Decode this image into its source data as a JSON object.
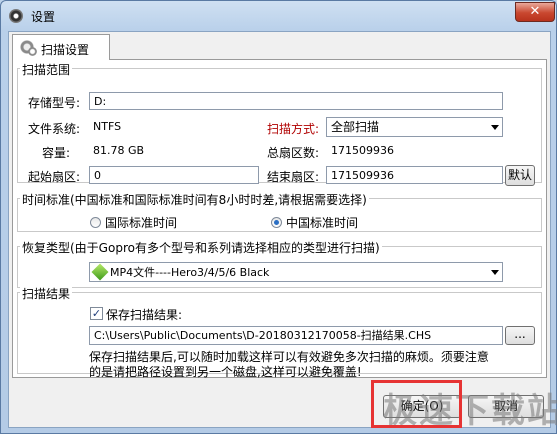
{
  "window": {
    "title": "设置",
    "close_glyph": "✕"
  },
  "tabs": [
    {
      "label": "扫描设置",
      "icon": "gear-icon"
    }
  ],
  "scan_range": {
    "title": "扫描范围",
    "storage_label": "存储型号:",
    "storage_value": "D:",
    "fs_label": "文件系统:",
    "fs_value": "NTFS",
    "method_label": "扫描方式:",
    "method_value": "全部扫描",
    "capacity_label": "容量:",
    "capacity_value": "81.78 GB",
    "total_sectors_label": "总扇区数:",
    "total_sectors_value": "171509936",
    "start_label": "起始扇区:",
    "start_value": "0",
    "end_label": "结束扇区:",
    "end_value": "171509936",
    "default_button": "默认"
  },
  "time_standard": {
    "title": "时间标准(中国标准和国际标准时间有8小时时差,请根据需要选择)",
    "options": [
      {
        "label": "国际标准时间",
        "selected": false
      },
      {
        "label": "中国标准时间",
        "selected": true
      }
    ]
  },
  "recovery_type": {
    "title": "恢复类型(由于Gopro有多个型号和系列请选择相应的类型进行扫描)",
    "selected": "MP4文件----Hero3/4/5/6 Black"
  },
  "scan_result": {
    "title": "扫描结果",
    "save_label": "保存扫描结果:",
    "save_checked": true,
    "path_value": "C:\\Users\\Public\\Documents\\D-20180312170058-扫描结果.CHS",
    "browse_button": "...",
    "note_line1": "保存扫描结果后,可以随时加载这样可以有效避免多次扫描的麻烦。须要注意",
    "note_line2": "的是请把路径设置到另一个磁盘,这样可以避免覆盖!"
  },
  "footer": {
    "ok_button": "确定(O)",
    "cancel_button": "取消"
  },
  "watermark": "极速下载站",
  "colors": {
    "accent_red": "#b00000",
    "highlight": "#e63333"
  }
}
